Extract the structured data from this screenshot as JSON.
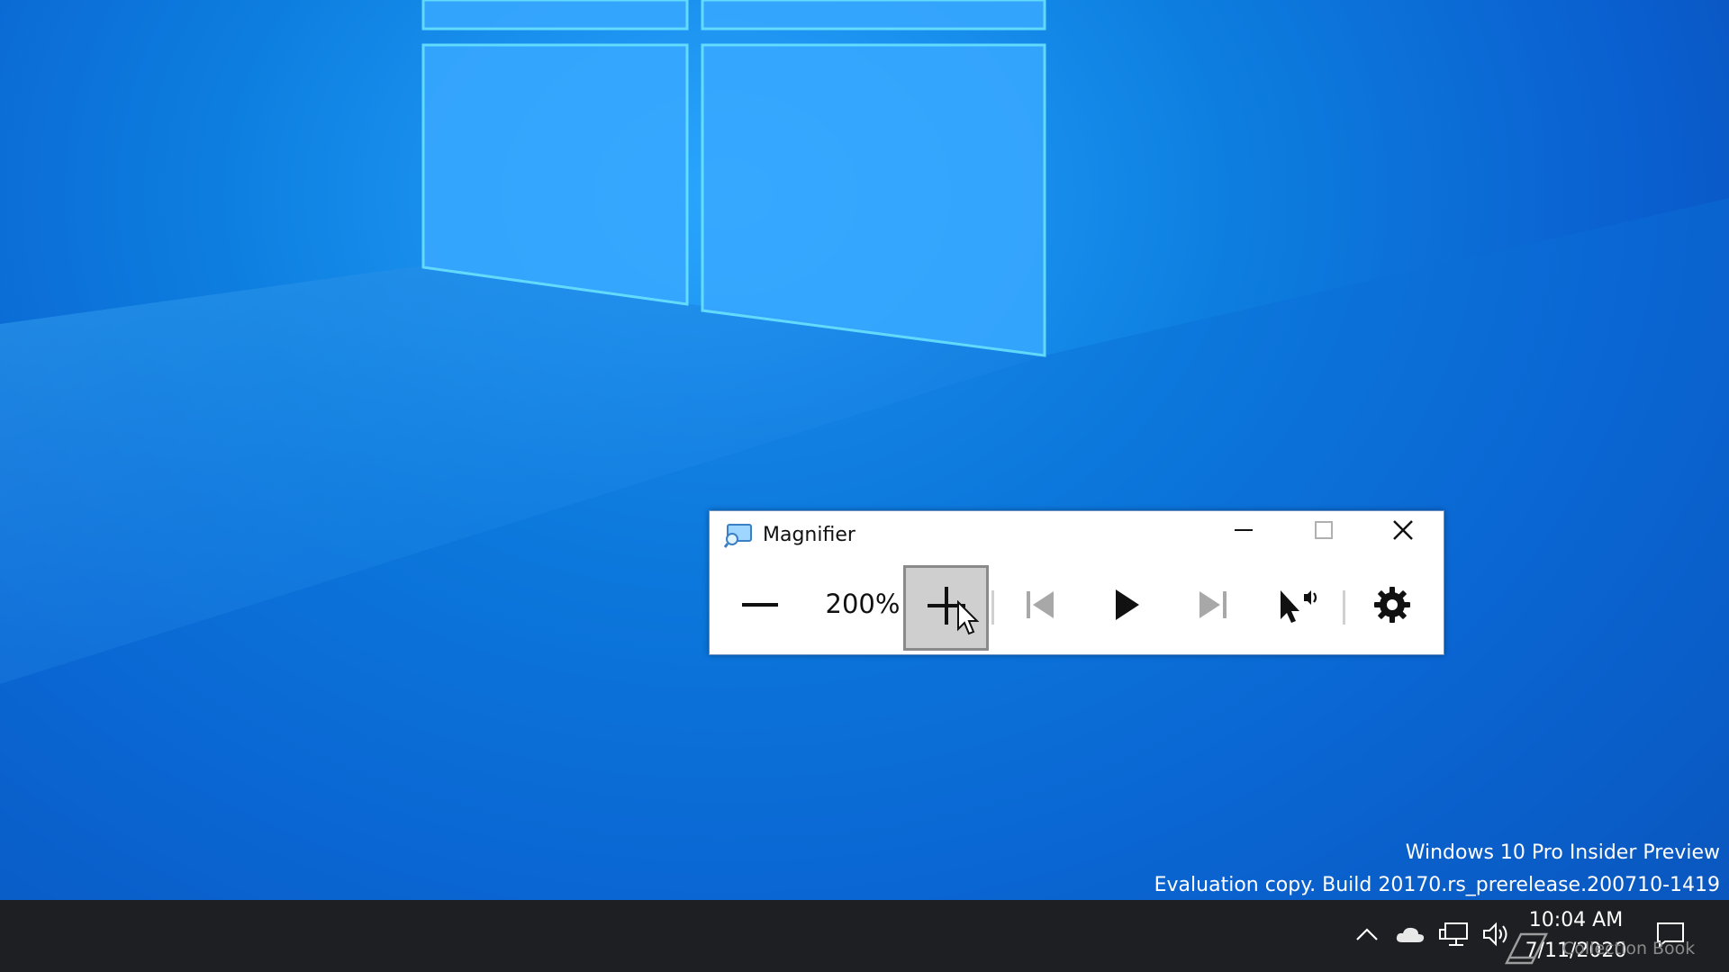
{
  "desktop": {
    "watermark_line1": "Windows 10 Pro Insider Preview",
    "watermark_line2": "Evaluation copy. Build 20170.rs_prerelease.200710-1419"
  },
  "magnifier": {
    "title": "Magnifier",
    "zoom_level": "200%",
    "titlebar_buttons": [
      "minimize-icon",
      "maximize-icon",
      "close-icon"
    ],
    "tools": [
      "zoom-out-icon",
      "zoom-in-icon",
      "previous-icon",
      "play-icon",
      "next-icon",
      "read-from-here-icon",
      "settings-icon"
    ]
  },
  "taskbar": {
    "time": "10:04 AM",
    "date": "7/11/2020",
    "overlay_text": "Collection Book",
    "tray_icons": [
      "chevron-up-icon",
      "onedrive-cloud-icon",
      "network-icon",
      "volume-icon",
      "notification-icon"
    ]
  },
  "colors": {
    "desktop_blue": "#0d7fe0",
    "taskbar": "#1d1f22",
    "window_background": "#ffffff",
    "zoom_in_pressed": "#cfcfcf"
  }
}
